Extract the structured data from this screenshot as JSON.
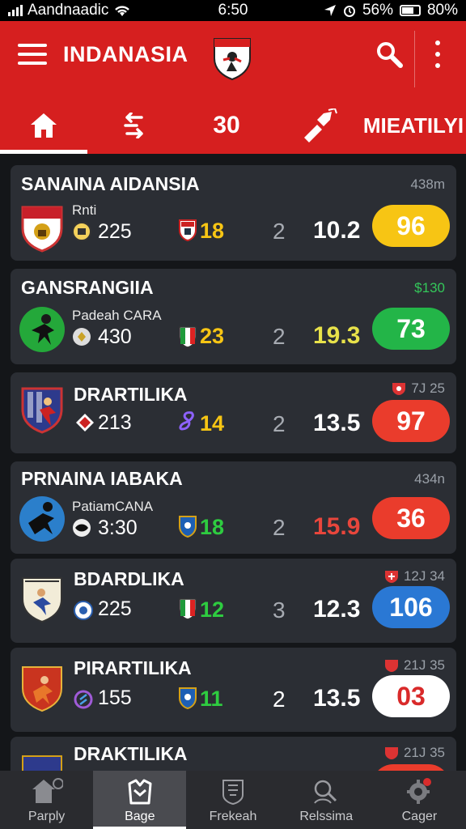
{
  "status": {
    "carrier": "Aandnaadic",
    "time": "6:50",
    "battery_pct": "56%",
    "other_pct": "80%"
  },
  "header": {
    "title": "INDANASIA"
  },
  "tabs": {
    "score": "30",
    "label": "MIEATILYI"
  },
  "matches": [
    {
      "league": "SANAINA AIDANSIA",
      "time": "438m",
      "player": "Rnti",
      "count": "225",
      "stat": "18",
      "mid": "2",
      "value": "10.2",
      "badge": "96",
      "badge_bg": "#f7c514",
      "badge_fg": "#ffffff"
    },
    {
      "league": "GANSRANGIIA",
      "time": "$130",
      "player": "Padeah CARA",
      "count": "430",
      "stat": "23",
      "mid": "2",
      "value": "19.3",
      "badge": "73",
      "badge_bg": "#23b548",
      "badge_fg": "#ffffff"
    },
    {
      "league": "DRARTILIKA",
      "time": "7J 25",
      "player": "",
      "count": "213",
      "stat": "14",
      "mid": "2",
      "value": "13.5",
      "badge": "97",
      "badge_bg": "#ea3c2c",
      "badge_fg": "#ffffff"
    },
    {
      "league": "PRNAINA IABAKA",
      "time": "434n",
      "player": "PatiamCANA",
      "count": "3:30",
      "stat": "18",
      "mid": "2",
      "value": "15.9",
      "badge": "36",
      "badge_bg": "#ea3c2c",
      "badge_fg": "#ffffff"
    },
    {
      "league": "BDARDLIKA",
      "time": "12J 34",
      "player": "",
      "count": "225",
      "stat": "12",
      "mid": "3",
      "value": "12.3",
      "badge": "106",
      "badge_bg": "#2a78d4",
      "badge_fg": "#ffffff"
    },
    {
      "league": "PIRARTILIKA",
      "time": "21J 35",
      "player": "",
      "count": "155",
      "stat": "11",
      "mid": "2",
      "value": "13.5",
      "badge": "03",
      "badge_bg": "#ffffff",
      "badge_fg": "#d92a2a"
    },
    {
      "league": "DRAKTILIKA",
      "time": "21J 35"
    }
  ],
  "bottom_nav": [
    "Parply",
    "Bage",
    "Frekeah",
    "Relssima",
    "Cager"
  ],
  "colors": {
    "accent": "#d61f1f",
    "background": "#16181c",
    "card": "#2b2e34"
  }
}
